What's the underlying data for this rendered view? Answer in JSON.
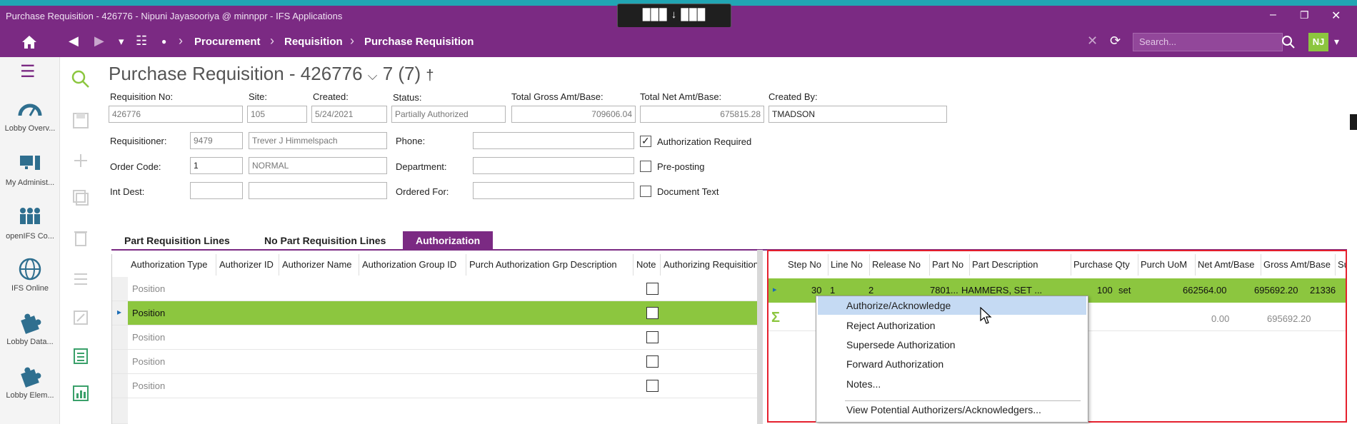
{
  "window": {
    "title": "Purchase Requisition - 426776 - Nipuni Jayasooriya @ minnppr - IFS Applications",
    "minimize": "–",
    "restore": "❐",
    "close": "✕",
    "grip": "███ ↓ ███"
  },
  "nav": {
    "back": "◀",
    "forward": "▶",
    "dropdown": "▾",
    "apps": "☷",
    "dot": "●",
    "crumbs": [
      "Procurement",
      "Requisition",
      "Purchase Requisition"
    ],
    "sep": "›",
    "close": "✕",
    "refresh": "⟳",
    "search_placeholder": "Search...",
    "avatar": "NJ",
    "avatar_menu": "▾"
  },
  "sidebar": {
    "menu_icon": "☰",
    "items": [
      {
        "label": "Lobby Overv...",
        "icon": "gauge-icon"
      },
      {
        "label": "My Administ...",
        "icon": "computer-icon"
      },
      {
        "label": "openIFS Co...",
        "icon": "people-icon"
      },
      {
        "label": "IFS Online",
        "icon": "globe-icon"
      },
      {
        "label": "Lobby Data...",
        "icon": "puzzle-icon"
      },
      {
        "label": "Lobby Elem...",
        "icon": "puzzle-icon"
      }
    ]
  },
  "header": {
    "title": "Purchase Requisition - 426776",
    "chevron": "⌵",
    "counter": "7 (7)",
    "pin": "†"
  },
  "form": {
    "req_no_label": "Requisition No:",
    "req_no": "426776",
    "site_label": "Site:",
    "site": "105",
    "created_label": "Created:",
    "created": "5/24/2021",
    "status_label": "Status:",
    "status": "Partially Authorized",
    "gross_label": "Total Gross Amt/Base:",
    "gross": "709606.04",
    "net_label": "Total Net Amt/Base:",
    "net": "675815.28",
    "created_by_label": "Created By:",
    "created_by": "TMADSON",
    "requisitioner_label": "Requisitioner:",
    "requisitioner_id": "9479",
    "requisitioner_name": "Trever J Himmelspach",
    "phone_label": "Phone:",
    "phone": "",
    "auth_required_label": "Authorization Required",
    "auth_required_check": "✓",
    "order_code_label": "Order Code:",
    "order_code": "1",
    "order_code_desc": "NORMAL",
    "department_label": "Department:",
    "department": "",
    "preposting_label": "Pre-posting",
    "int_dest_label": "Int Dest:",
    "int_dest": "",
    "int_dest_desc": "",
    "ordered_for_label": "Ordered For:",
    "ordered_for": "",
    "doc_text_label": "Document Text"
  },
  "tabs": [
    "Part Requisition Lines",
    "No Part Requisition Lines",
    "Authorization"
  ],
  "auth_grid": {
    "columns": [
      "Authorization Type",
      "Authorizer ID",
      "Authorizer Name",
      "Authorization Group ID",
      "Purch Authorization Grp Description",
      "Note",
      "Authorizing Requisitione"
    ],
    "rows": [
      "Position",
      "Position",
      "Position",
      "Position",
      "Position"
    ],
    "row_marker": "▸"
  },
  "lines_grid": {
    "columns": [
      "Step No",
      "Line No",
      "Release No",
      "Part No",
      "Part Description",
      "Purchase Qty",
      "Purch UoM",
      "Net Amt/Base",
      "Gross Amt/Base",
      "Supplie"
    ],
    "row": {
      "marker": "▸",
      "step_no": "30",
      "line_no": "1",
      "release_no": "2",
      "part_no": "7801...",
      "part_description": "HAMMERS, SET ...",
      "purchase_qty": "100",
      "uom": "set",
      "net": "662564.00",
      "gross": "695692.20",
      "supplier": "21336"
    },
    "sum": {
      "symbol": "Σ",
      "net": "0.00",
      "gross": "695692.20"
    }
  },
  "context_menu": {
    "items": [
      "Authorize/Acknowledge",
      "Reject Authorization",
      "Supersede Authorization",
      "Forward Authorization",
      "Notes...",
      "View Potential Authorizers/Acknowledgers..."
    ]
  },
  "colors": {
    "brand": "#7b2a83",
    "selection": "#8cc63f",
    "highlight_border": "#e5202d"
  }
}
